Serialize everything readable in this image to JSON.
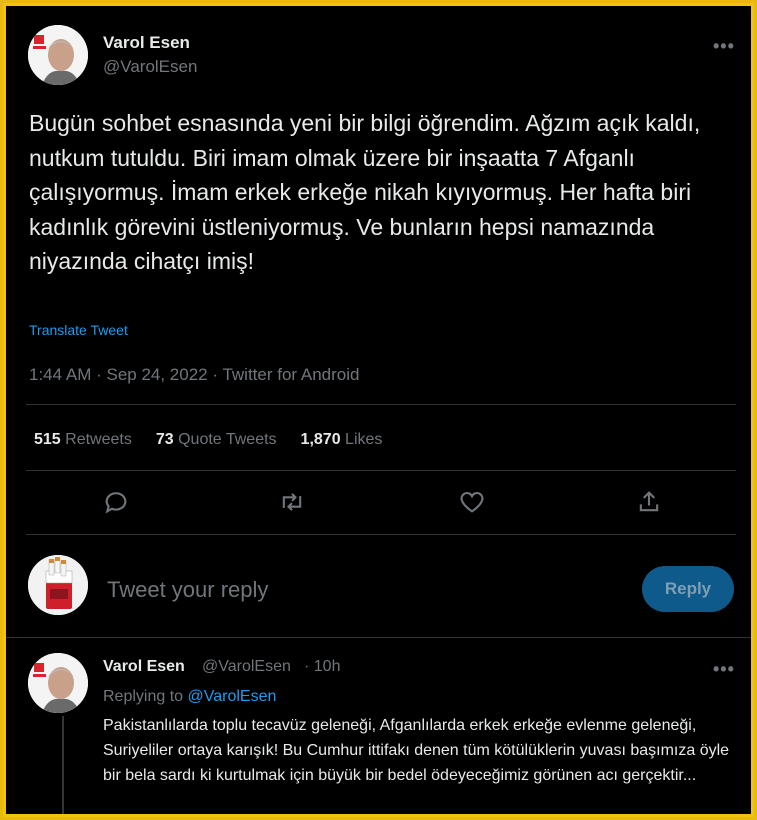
{
  "tweet": {
    "author_name": "Varol Esen",
    "author_handle": "@VarolEsen",
    "text": "Bugün sohbet esnasında yeni bir bilgi öğrendim. Ağzım açık kaldı, nutkum tutuldu. Biri imam olmak üzere bir inşaatta 7 Afganlı çalışıyormuş. İmam erkek erkeğe nikah kıyıyormuş. Her hafta biri kadınlık görevini üstleniyormuş. Ve bunların hepsi namazında niyazında cihatçı imiş!",
    "translate_label": "Translate Tweet",
    "time": "1:44 AM",
    "date": "Sep 24, 2022",
    "source": "Twitter for Android",
    "separator": " · ",
    "stats": {
      "retweets_count": "515",
      "retweets_label": "Retweets",
      "quotes_count": "73",
      "quotes_label": "Quote Tweets",
      "likes_count": "1,870",
      "likes_label": "Likes"
    }
  },
  "actions": [
    {
      "icon": "comment-icon"
    },
    {
      "icon": "retweet-icon"
    },
    {
      "icon": "heart-icon"
    },
    {
      "icon": "share-icon"
    }
  ],
  "composer": {
    "placeholder": "Tweet your reply",
    "button_label": "Reply"
  },
  "reply_tweet": {
    "author_name": "Varol Esen",
    "author_handle": "@VarolEsen",
    "time_ago": "· 10h",
    "replying_prefix": "Replying to ",
    "replying_to": "@VarolEsen",
    "text": "Pakistanlılarda toplu tecavüz geleneği, Afganlılarda erkek erkeğe evlenme geleneği, Suriyeliler ortaya karışık! Bu Cumhur ittifakı denen tüm kötülüklerin yuvası başımıza öyle bir bela sardı ki kurtulmak için büyük bir bedel ödeyeceğimiz görünen acı gerçektir..."
  },
  "more_label": "•••",
  "colors": {
    "background": "#000000",
    "text": "#e7e9ea",
    "muted": "#71767b",
    "link": "#1d9bf0",
    "frame": "#f3c20f"
  }
}
